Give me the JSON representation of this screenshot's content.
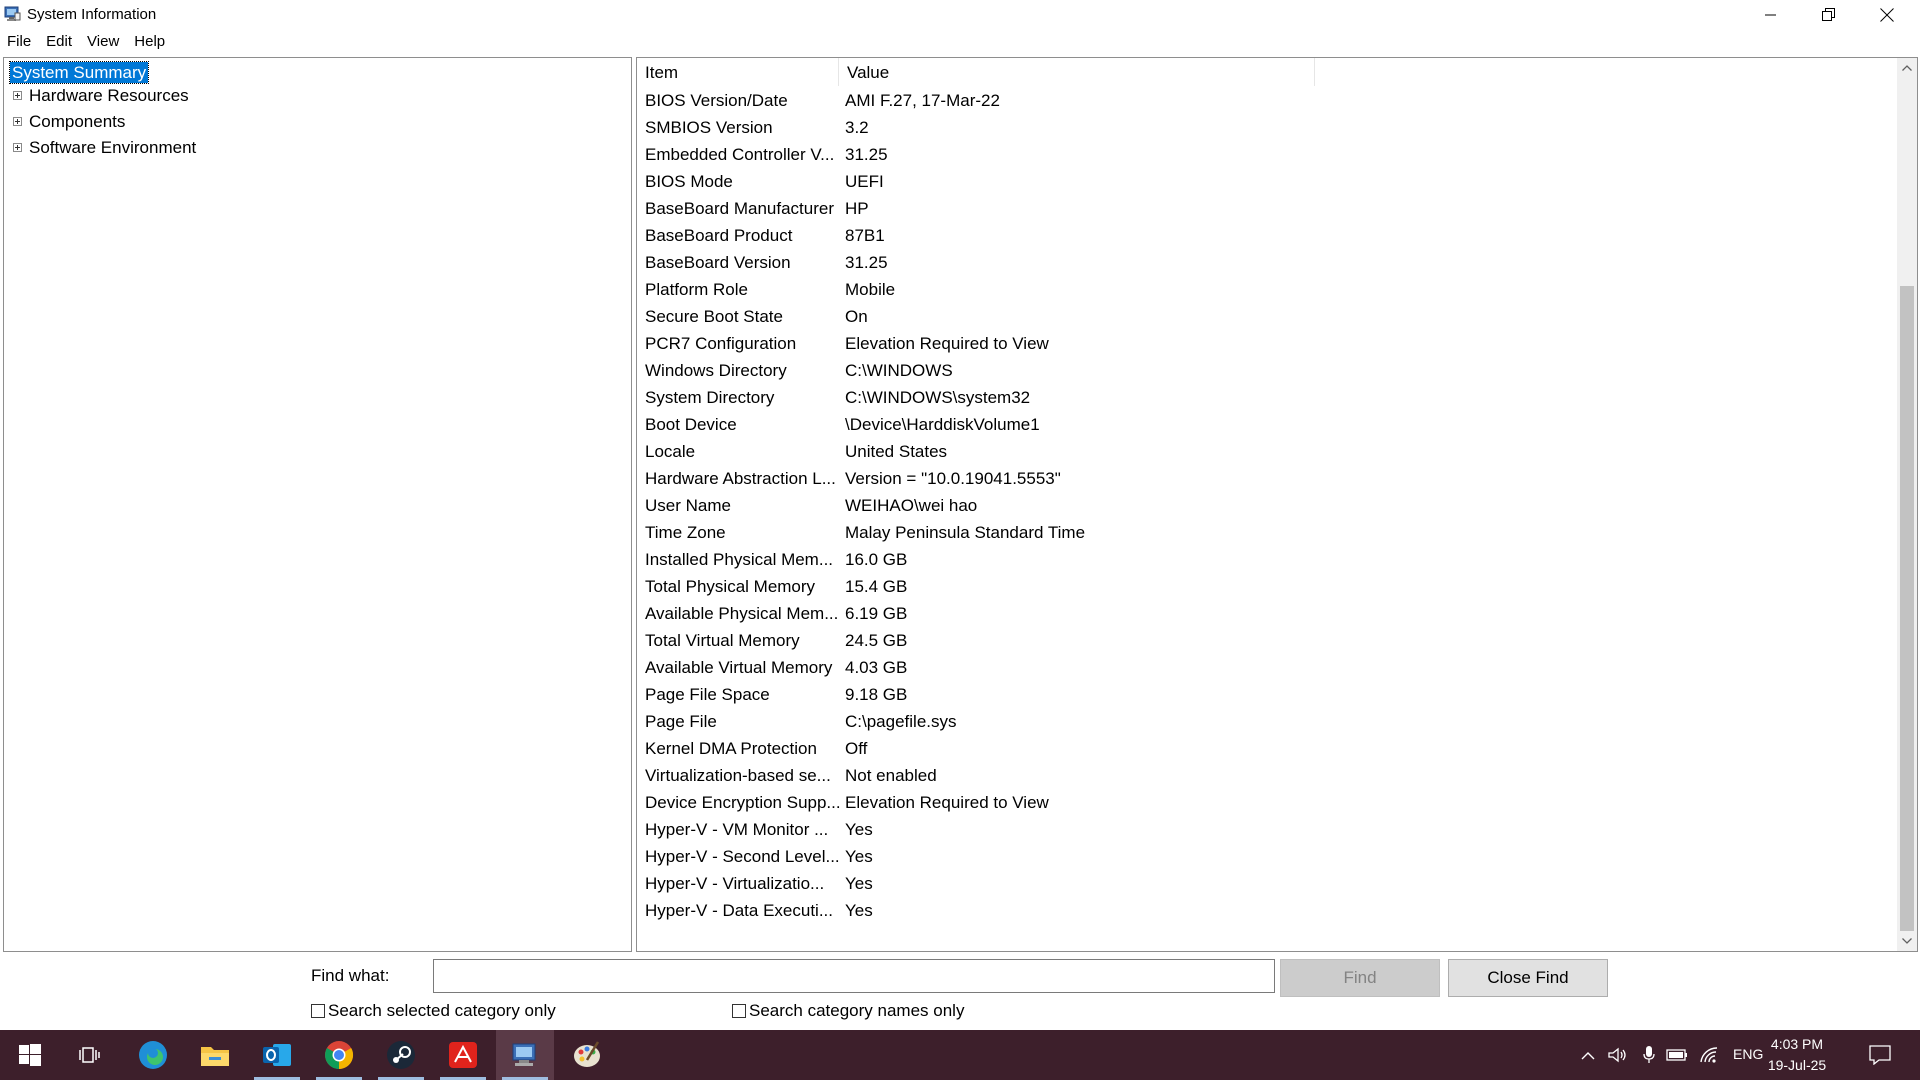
{
  "window": {
    "title": "System Information",
    "menu": [
      "File",
      "Edit",
      "View",
      "Help"
    ]
  },
  "tree": {
    "selected": "System Summary",
    "items": [
      {
        "label": "System Summary",
        "expandable": false
      },
      {
        "label": "Hardware Resources",
        "expandable": true
      },
      {
        "label": "Components",
        "expandable": true
      },
      {
        "label": "Software Environment",
        "expandable": true
      }
    ]
  },
  "list": {
    "headers": {
      "item": "Item",
      "value": "Value"
    },
    "rows": [
      {
        "item": "BIOS Version/Date",
        "value": "AMI F.27, 17-Mar-22"
      },
      {
        "item": "SMBIOS Version",
        "value": "3.2"
      },
      {
        "item": "Embedded Controller V...",
        "value": "31.25"
      },
      {
        "item": "BIOS Mode",
        "value": "UEFI"
      },
      {
        "item": "BaseBoard Manufacturer",
        "value": "HP"
      },
      {
        "item": "BaseBoard Product",
        "value": "87B1"
      },
      {
        "item": "BaseBoard Version",
        "value": "31.25"
      },
      {
        "item": "Platform Role",
        "value": "Mobile"
      },
      {
        "item": "Secure Boot State",
        "value": "On"
      },
      {
        "item": "PCR7 Configuration",
        "value": "Elevation Required to View"
      },
      {
        "item": "Windows Directory",
        "value": "C:\\WINDOWS"
      },
      {
        "item": "System Directory",
        "value": "C:\\WINDOWS\\system32"
      },
      {
        "item": "Boot Device",
        "value": "\\Device\\HarddiskVolume1"
      },
      {
        "item": "Locale",
        "value": "United States"
      },
      {
        "item": "Hardware Abstraction L...",
        "value": "Version = \"10.0.19041.5553\""
      },
      {
        "item": "User Name",
        "value": "WEIHAO\\wei hao"
      },
      {
        "item": "Time Zone",
        "value": "Malay Peninsula Standard Time"
      },
      {
        "item": "Installed Physical Mem...",
        "value": "16.0 GB"
      },
      {
        "item": "Total Physical Memory",
        "value": "15.4 GB"
      },
      {
        "item": "Available Physical Mem...",
        "value": "6.19 GB"
      },
      {
        "item": "Total Virtual Memory",
        "value": "24.5 GB"
      },
      {
        "item": "Available Virtual Memory",
        "value": "4.03 GB"
      },
      {
        "item": "Page File Space",
        "value": "9.18 GB"
      },
      {
        "item": "Page File",
        "value": "C:\\pagefile.sys"
      },
      {
        "item": "Kernel DMA Protection",
        "value": "Off"
      },
      {
        "item": "Virtualization-based se...",
        "value": "Not enabled"
      },
      {
        "item": "Device Encryption Supp...",
        "value": "Elevation Required to View"
      },
      {
        "item": "Hyper-V - VM Monitor ...",
        "value": "Yes"
      },
      {
        "item": "Hyper-V - Second Level...",
        "value": "Yes"
      },
      {
        "item": "Hyper-V - Virtualizatio...",
        "value": "Yes"
      },
      {
        "item": "Hyper-V - Data Executi...",
        "value": "Yes"
      }
    ]
  },
  "find": {
    "label": "Find what:",
    "value": "",
    "find_button": "Find",
    "close_button": "Close Find",
    "option1": "Search selected category only",
    "option2": "Search category names only"
  },
  "taskbar": {
    "apps": [
      "start-icon",
      "task-view-icon",
      "edge-icon",
      "file-explorer-icon",
      "outlook-icon",
      "chrome-icon",
      "steam-icon",
      "adobe-acrobat-icon",
      "system-information-icon",
      "paint-icon"
    ],
    "language": "ENG",
    "time": "4:03 PM",
    "date": "19-Jul-25"
  },
  "colors": {
    "selection": "#0078d7",
    "taskbar": "#3d1f2b"
  }
}
